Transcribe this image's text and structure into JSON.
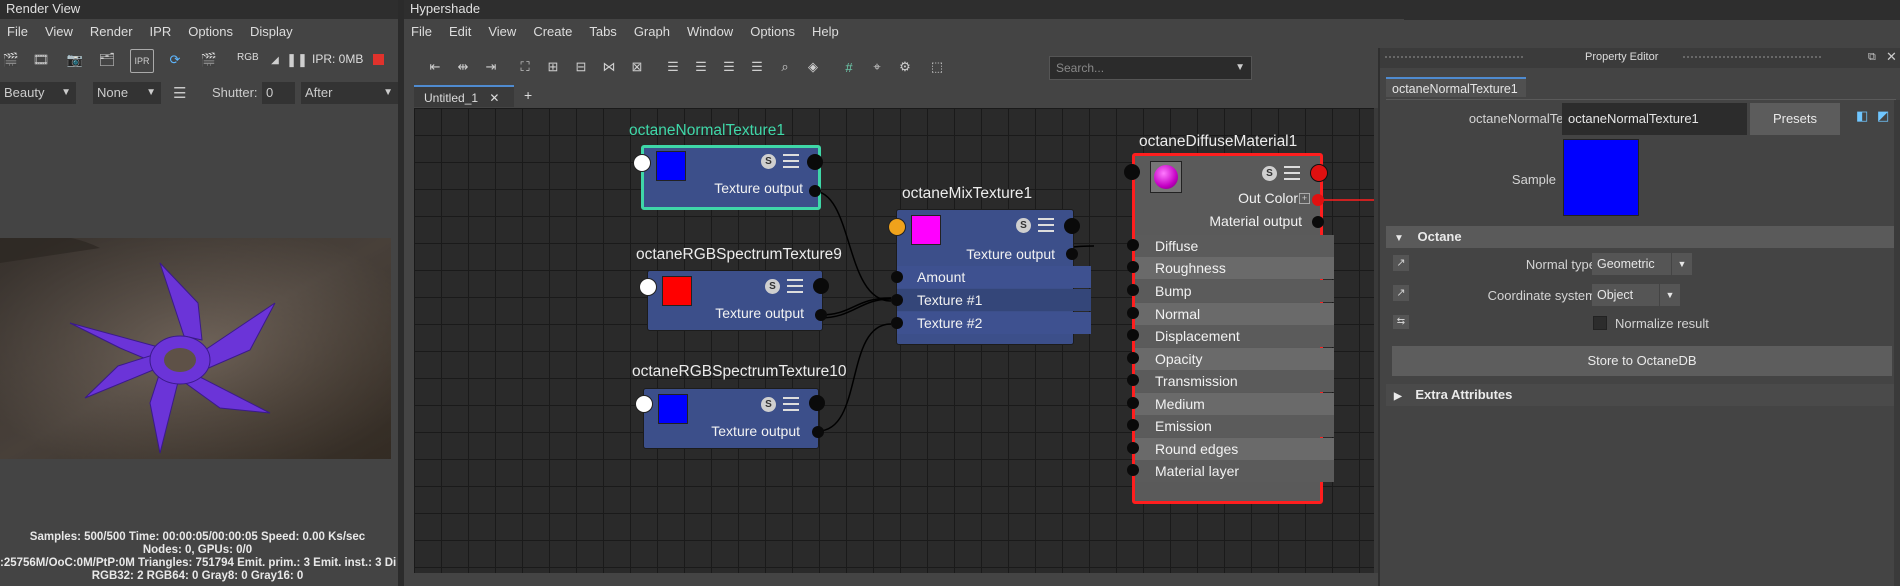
{
  "render_view": {
    "title": "Render View",
    "menu": [
      "File",
      "View",
      "Render",
      "IPR",
      "Options",
      "Display"
    ],
    "toolbar": {
      "rgb_label": "RGB",
      "ipr_memory": "IPR: 0MB",
      "icons": [
        "render-icon",
        "render-region-icon",
        "snapshot-icon",
        "keep-image-icon",
        "ipr-icon",
        "refresh-ipr-icon",
        "render-sequence-icon",
        "alpha-icon",
        "pause-icon",
        "stop-icon"
      ]
    },
    "pass_select": "Beauty",
    "layer_select": "None",
    "shutter_label": "Shutter:",
    "shutter_value": "0",
    "after_select": "After",
    "stats": [
      "Samples: 500/500 Time: 00:00:05/00:00:05 Speed: 0.00 Ks/sec",
      "Nodes: 0, GPUs: 0/0",
      ":25756M/OoC:0M/PtP:0M Triangles: 751794 Emit. prim.: 3 Emit. inst.: 3 Di",
      "RGB32: 2 RGB64: 0 Gray8: 0 Gray16: 0"
    ]
  },
  "hypershade": {
    "title": "Hypershade",
    "menu": [
      "File",
      "Edit",
      "View",
      "Create",
      "Tabs",
      "Graph",
      "Window",
      "Options",
      "Help"
    ],
    "search_placeholder": "Search...",
    "tabs": [
      {
        "label": "Untitled_1",
        "close": "✕"
      }
    ],
    "add_tab": "+",
    "nodes": {
      "normal_texture": {
        "title": "octaneNormalTexture1",
        "swatch": "#0000ff",
        "output": "Texture output"
      },
      "rgb9": {
        "title": "octaneRGBSpectrumTexture9",
        "swatch": "#ff0000",
        "output": "Texture output"
      },
      "rgb10": {
        "title": "octaneRGBSpectrumTexture10",
        "swatch": "#0000ff",
        "output": "Texture output"
      },
      "mix": {
        "title": "octaneMixTexture1",
        "swatch": "#ff00ff",
        "output": "Texture output",
        "inputs": [
          "Amount",
          "Texture #1",
          "Texture #2"
        ]
      },
      "diffuse": {
        "title": "octaneDiffuseMaterial1",
        "out_color": "Out Color",
        "output": "Material output",
        "inputs": [
          "Diffuse",
          "Roughness",
          "Bump",
          "Normal",
          "Displacement",
          "Opacity",
          "Transmission",
          "Medium",
          "Emission",
          "Round edges",
          "Material layer"
        ]
      }
    }
  },
  "property_editor": {
    "title": "Property Editor",
    "tab": "octaneNormalTexture1",
    "name_label": "octaneNormalTexture:",
    "name_value": "octaneNormalTexture1",
    "presets_label": "Presets",
    "sample_label": "Sample",
    "sample_color": "#0000ff",
    "section_octane": "Octane",
    "normal_type_label": "Normal type",
    "normal_type_value": "Geometric",
    "coord_label": "Coordinate system",
    "coord_value": "Object",
    "normalize_label": "Normalize result",
    "normalize_checked": false,
    "store_button": "Store to OctaneDB",
    "section_extra": "Extra Attributes"
  },
  "colors": {
    "selection_green": "#3fd7a8",
    "selection_red": "#ff1e1e",
    "node_blue": "#3c4f8a"
  }
}
